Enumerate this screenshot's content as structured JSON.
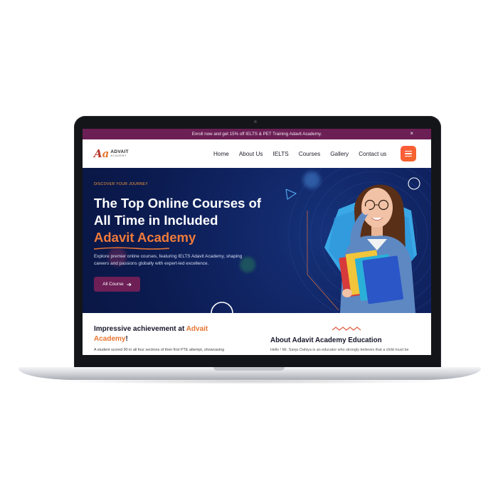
{
  "announcement": {
    "text": "Enroll now and get 15% off IELTS & PET Training Adavit Academy.",
    "close_label": "×"
  },
  "logo": {
    "mark_a": "A",
    "mark_a2": "a",
    "name": "ADVAIT",
    "sub": "ACADEMY"
  },
  "nav": {
    "items": [
      "Home",
      "About Us",
      "IELTS",
      "Courses",
      "Gallery",
      "Contact us"
    ]
  },
  "hero": {
    "kicker": "DISCOVER YOUR JOURNEY",
    "headline": "The Top Online Courses of All Time in Included",
    "accent": "Adavit Academy",
    "description": "Explore premier online courses, featuring IELTS Adavit Academy, shaping careers and passions globally with expert-led excellence.",
    "cta_label": "All Course",
    "cta_icon": "arrow-right-icon"
  },
  "achievement": {
    "title_prefix": "Impressive achievement at ",
    "title_brand": "Advait Academy",
    "title_suffix": "!",
    "text": "A student scored 90 in all four sections of their first PTE attempt, showcasing"
  },
  "about": {
    "title": "About Adavit Academy Education",
    "text": "Hello ! Mr. Sanju Dahiya is an educator who strongly believes that a child must be"
  },
  "colors": {
    "announcement_bg": "#6b1f55",
    "hero_bg": "#0f2360",
    "accent_orange": "#f07a3a",
    "cta_bg": "#6d1f56",
    "menu_button": "#f1662a"
  }
}
